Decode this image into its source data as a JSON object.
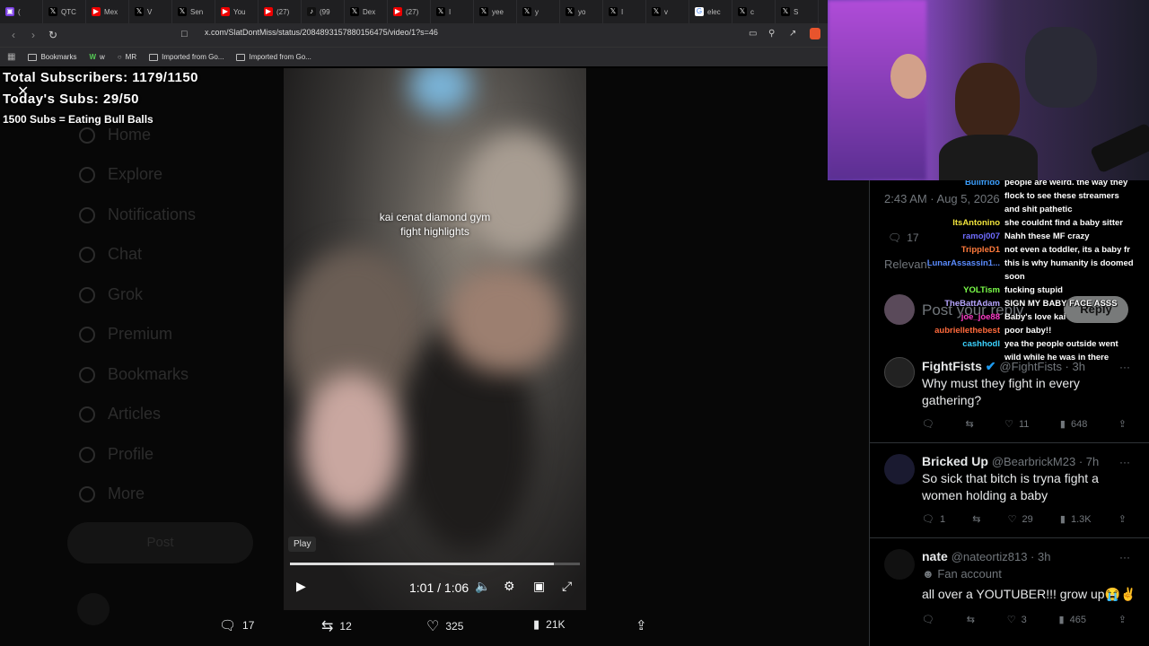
{
  "browser": {
    "tabs": [
      {
        "icon": "twitch",
        "label": "( "
      },
      {
        "icon": "x",
        "label": "QTC"
      },
      {
        "icon": "youtube",
        "label": "Mex"
      },
      {
        "icon": "x",
        "label": "V"
      },
      {
        "icon": "x",
        "label": "Sen"
      },
      {
        "icon": "youtube",
        "label": "You"
      },
      {
        "icon": "youtube",
        "label": "(27)"
      },
      {
        "icon": "tiktok",
        "label": "(99"
      },
      {
        "icon": "x",
        "label": "Dex"
      },
      {
        "icon": "youtube",
        "label": "(27)"
      },
      {
        "icon": "x",
        "label": "I"
      },
      {
        "icon": "x",
        "label": "yee"
      },
      {
        "icon": "x",
        "label": "y"
      },
      {
        "icon": "x",
        "label": "yo"
      },
      {
        "icon": "x",
        "label": "I"
      },
      {
        "icon": "x",
        "label": "v"
      },
      {
        "icon": "google",
        "label": "elec"
      },
      {
        "icon": "x",
        "label": "c"
      },
      {
        "icon": "x",
        "label": "S"
      }
    ],
    "url": "x.com/SlatDontMiss/status/2084893157880156475/video/1?s=46",
    "bookmarks": [
      "Bookmarks",
      "w",
      "MR",
      "Imported from Go...",
      "Imported from Go..."
    ]
  },
  "overlay": {
    "total_subs": "Total Subscribers: 1179/1150",
    "todays_subs": "Today's Subs: 29/50",
    "goal": "1500 Subs = Eating Bull Balls"
  },
  "sidebar_dim": [
    "Home",
    "Explore",
    "Notifications",
    "Chat",
    "Grok",
    "Premium",
    "Bookmarks",
    "Articles",
    "Profile",
    "More"
  ],
  "sidebar_post": "Post",
  "video": {
    "caption_line1": "kai cenat diamond gym",
    "caption_line2": "fight highlights",
    "play_tooltip": "Play",
    "timecode": "1:01 / 1:06",
    "progress": 0.91
  },
  "actions": {
    "replies": "17",
    "reposts": "12",
    "likes": "325",
    "views": "21K"
  },
  "right": {
    "timestamp": "2:43 AM · Aug 5, 2026",
    "replies_count": "17",
    "relevant": "Relevant",
    "reply_placeholder": "Post your reply",
    "reply_button": "Reply",
    "tweets": [
      {
        "name": "FightFists",
        "handle": "@FightFists · 3h",
        "text": "Why must they fight in every gathering?",
        "reply": "",
        "repost": "",
        "like": "11",
        "views": "648",
        "verified": true
      },
      {
        "name": "Bricked Up",
        "handle": "@BearbrickM23 · 7h",
        "text": "So sick that bitch is tryna fight a women holding a baby",
        "reply": "1",
        "repost": "",
        "like": "29",
        "views": "1.3K",
        "verified": false
      },
      {
        "name": "nate",
        "handle": "@nateortiz813 · 3h",
        "badge": "Fan account",
        "text": "all over a YOUTUBER!!! grow up😭✌️",
        "reply": "",
        "repost": "",
        "like": "3",
        "views": "465",
        "verified": false
      }
    ]
  },
  "chat": [
    {
      "user": "Bullfrido",
      "color": "#3da0ff",
      "msg": "people are weird. the way they"
    },
    {
      "user": "",
      "color": "#ffffff",
      "msg": "flock to see these streamers"
    },
    {
      "user": "",
      "color": "#ffffff",
      "msg": "and shit pathetic"
    },
    {
      "user": "ItsAntonino",
      "color": "#f0e33c",
      "msg": "she couldnt find a baby sitter"
    },
    {
      "user": "ramoj007",
      "color": "#6f6cff",
      "msg": "Nahh these MF crazy"
    },
    {
      "user": "TrippleD1",
      "color": "#ff7a3c",
      "msg": "not even a toddler, its a baby fr"
    },
    {
      "user": "LunarAssassin1...",
      "color": "#5b8cff",
      "msg": "this is why humanity is doomed"
    },
    {
      "user": "",
      "color": "#ffffff",
      "msg": "soon"
    },
    {
      "user": "YOLTism",
      "color": "#7cff4a",
      "msg": "fucking stupid"
    },
    {
      "user": "TheBattAdam",
      "color": "#b7a6ff",
      "msg": "SIGN MY BABY FACE ASSS"
    },
    {
      "user": "joe_joe88",
      "color": "#ff3cc8",
      "msg": "Baby's love kai"
    },
    {
      "user": "aubriellethebest",
      "color": "#ff6a3c",
      "msg": "poor baby!!"
    },
    {
      "user": "cashhodl",
      "color": "#3cd2ff",
      "msg": "yea the people outside went"
    },
    {
      "user": "",
      "color": "#ffffff",
      "msg": "wild while he was in there"
    }
  ]
}
